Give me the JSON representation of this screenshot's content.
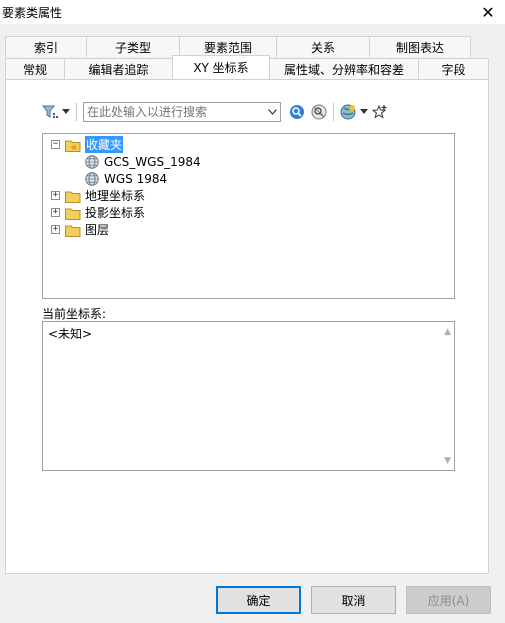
{
  "window": {
    "title": "要素类属性",
    "close_glyph": "✕"
  },
  "tabs_back": [
    "索引",
    "子类型",
    "要素范围",
    "关系",
    "制图表达"
  ],
  "tabs_front": [
    "常规",
    "编辑者追踪",
    "XY 坐标系",
    "属性域、分辨率和容差",
    "字段"
  ],
  "active_tab": "XY 坐标系",
  "toolbar": {
    "search_placeholder": "在此处输入以进行搜索"
  },
  "tree": {
    "favorites": "收藏夹",
    "fav_items": [
      "GCS_WGS_1984",
      "WGS 1984"
    ],
    "folders": [
      "地理坐标系",
      "投影坐标系",
      "图层"
    ],
    "expanded": "−",
    "collapsed": "+"
  },
  "current": {
    "label": "当前坐标系:",
    "value": "<未知>"
  },
  "buttons": {
    "ok": "确定",
    "cancel": "取消",
    "apply": "应用(A)"
  }
}
